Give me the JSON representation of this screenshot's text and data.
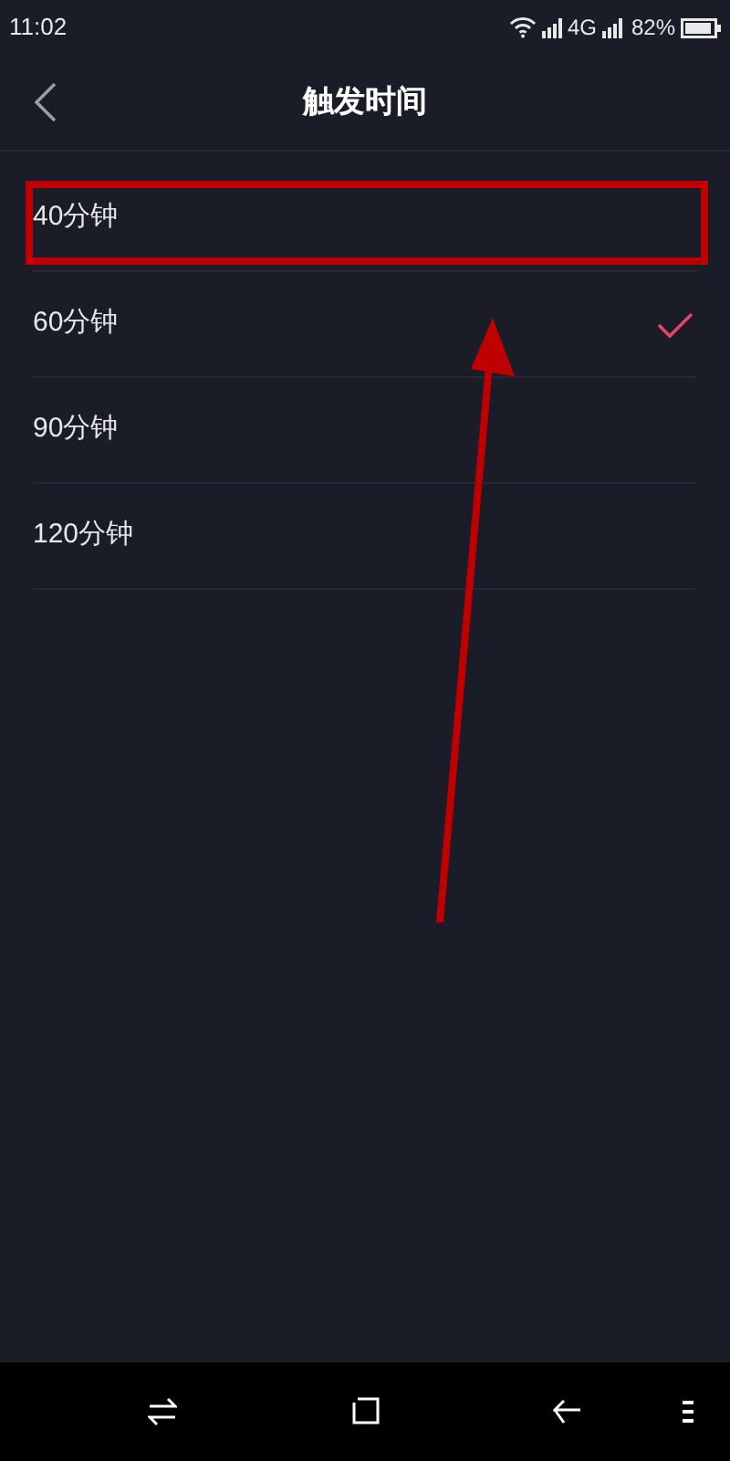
{
  "status_bar": {
    "time": "11:02",
    "network": "4G",
    "battery": "82%"
  },
  "header": {
    "title": "触发时间"
  },
  "options": [
    {
      "label": "40分钟",
      "selected": false
    },
    {
      "label": "60分钟",
      "selected": true
    },
    {
      "label": "90分钟",
      "selected": false
    },
    {
      "label": "120分钟",
      "selected": false
    }
  ]
}
